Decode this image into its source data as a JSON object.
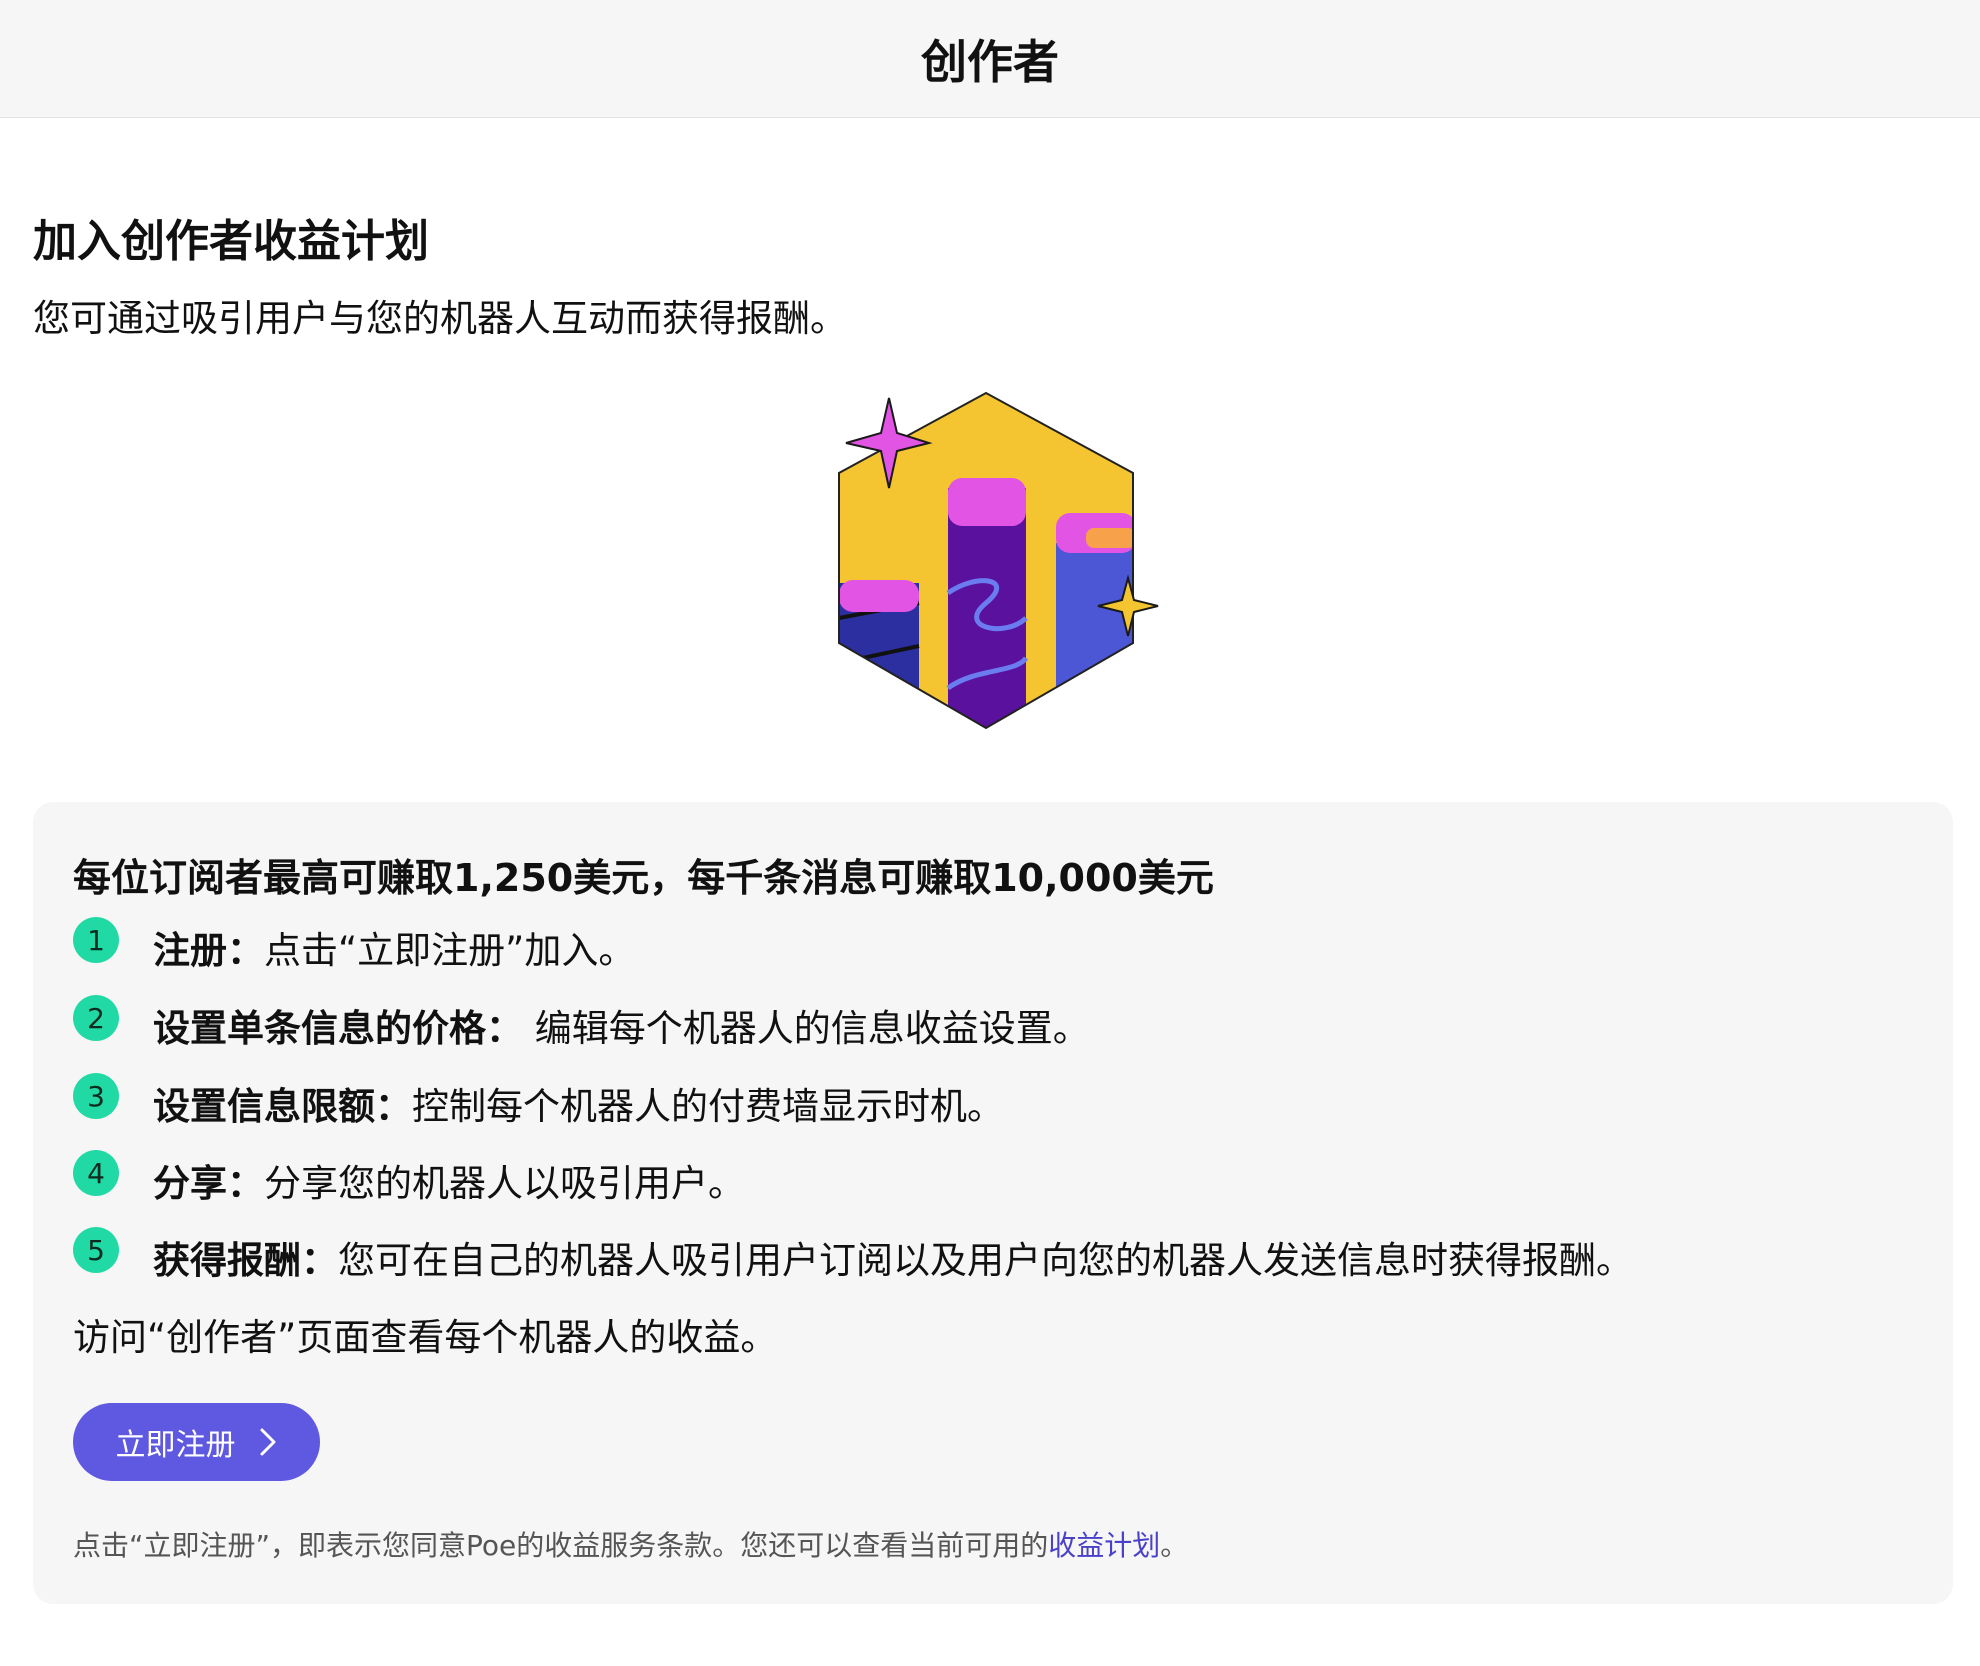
{
  "header": {
    "title": "创作者"
  },
  "intro": {
    "heading": "加入创作者收益计划",
    "subtitle": "您可通过吸引用户与您的机器人互动而获得报酬。"
  },
  "card": {
    "heading": "每位订阅者最高可赚取1,250美元，每千条消息可赚取10,000美元",
    "steps": [
      {
        "num": "1",
        "title": "注册：",
        "desc": "点击“立即注册”加入。"
      },
      {
        "num": "2",
        "title": "设置单条信息的价格：",
        "desc": " 编辑每个机器人的信息收益设置。"
      },
      {
        "num": "3",
        "title": "设置信息限额：",
        "desc": "控制每个机器人的付费墙显示时机。"
      },
      {
        "num": "4",
        "title": "分享：",
        "desc": "分享您的机器人以吸引用户。"
      },
      {
        "num": "5",
        "title": "获得报酬：",
        "desc": "您可在自己的机器人吸引用户订阅以及用户向您的机器人发送信息时获得报酬。"
      }
    ],
    "visit_text": "访问“创作者”页面查看每个机器人的收益。",
    "signup_label": "立即注册",
    "terms_text": "点击“立即注册”，即表示您同意Poe的收益服务条款。您还可以查看当前可用的",
    "terms_link": "收益计划",
    "terms_end": "。"
  },
  "colors": {
    "accent": "#5f58e0",
    "step_badge": "#21d9a4",
    "link": "#4a41c9"
  },
  "icons": {
    "hero": "earnings-bar-chart-illustration",
    "button": "chevron-right-icon"
  }
}
